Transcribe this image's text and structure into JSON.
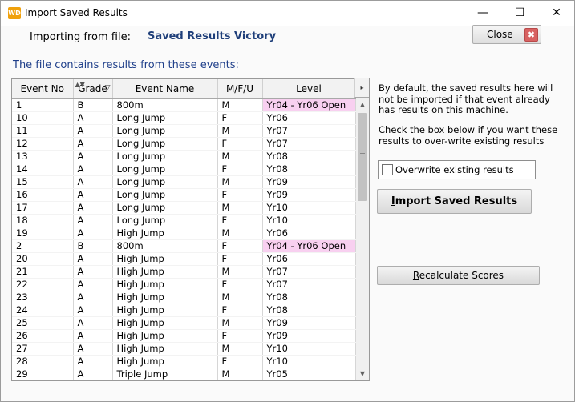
{
  "window": {
    "title": "Import Saved Results",
    "icon_name": "app-logo-icon",
    "app_icon_text": "WD",
    "min_glyph": "—",
    "max_glyph": "☐",
    "close_glyph": "✕"
  },
  "header": {
    "import_label": "Importing from file:",
    "file_name": "Saved Results Victory",
    "close_button": "Close",
    "close_icon_glyph": "✖"
  },
  "events_heading": "The file contains results from these events:",
  "grid": {
    "columns": [
      "Event No",
      "Grade",
      "Event Name",
      "M/F/U",
      "Level"
    ],
    "sort_glyph": "▲▼",
    "filter_glyph": "▽",
    "col_scroll_glyph": "▸",
    "scroll_up_glyph": "▲",
    "scroll_down_glyph": "▼",
    "rows": [
      {
        "event_no": "1",
        "grade": "B",
        "event_name": "800m",
        "mfu": "M",
        "level": "Yr04 - Yr06 Open",
        "highlight": true
      },
      {
        "event_no": "10",
        "grade": "A",
        "event_name": "Long Jump",
        "mfu": "F",
        "level": "Yr06"
      },
      {
        "event_no": "11",
        "grade": "A",
        "event_name": "Long Jump",
        "mfu": "M",
        "level": "Yr07"
      },
      {
        "event_no": "12",
        "grade": "A",
        "event_name": "Long Jump",
        "mfu": "F",
        "level": "Yr07"
      },
      {
        "event_no": "13",
        "grade": "A",
        "event_name": "Long Jump",
        "mfu": "M",
        "level": "Yr08"
      },
      {
        "event_no": "14",
        "grade": "A",
        "event_name": "Long Jump",
        "mfu": "F",
        "level": "Yr08"
      },
      {
        "event_no": "15",
        "grade": "A",
        "event_name": "Long Jump",
        "mfu": "M",
        "level": "Yr09"
      },
      {
        "event_no": "16",
        "grade": "A",
        "event_name": "Long Jump",
        "mfu": "F",
        "level": "Yr09"
      },
      {
        "event_no": "17",
        "grade": "A",
        "event_name": "Long Jump",
        "mfu": "M",
        "level": "Yr10"
      },
      {
        "event_no": "18",
        "grade": "A",
        "event_name": "Long Jump",
        "mfu": "F",
        "level": "Yr10"
      },
      {
        "event_no": "19",
        "grade": "A",
        "event_name": "High Jump",
        "mfu": "M",
        "level": "Yr06"
      },
      {
        "event_no": "2",
        "grade": "B",
        "event_name": "800m",
        "mfu": "F",
        "level": "Yr04 - Yr06 Open",
        "highlight": true
      },
      {
        "event_no": "20",
        "grade": "A",
        "event_name": "High Jump",
        "mfu": "F",
        "level": "Yr06"
      },
      {
        "event_no": "21",
        "grade": "A",
        "event_name": "High Jump",
        "mfu": "M",
        "level": "Yr07"
      },
      {
        "event_no": "22",
        "grade": "A",
        "event_name": "High Jump",
        "mfu": "F",
        "level": "Yr07"
      },
      {
        "event_no": "23",
        "grade": "A",
        "event_name": "High Jump",
        "mfu": "M",
        "level": "Yr08"
      },
      {
        "event_no": "24",
        "grade": "A",
        "event_name": "High Jump",
        "mfu": "F",
        "level": "Yr08"
      },
      {
        "event_no": "25",
        "grade": "A",
        "event_name": "High Jump",
        "mfu": "M",
        "level": "Yr09"
      },
      {
        "event_no": "26",
        "grade": "A",
        "event_name": "High Jump",
        "mfu": "F",
        "level": "Yr09"
      },
      {
        "event_no": "27",
        "grade": "A",
        "event_name": "High Jump",
        "mfu": "M",
        "level": "Yr10"
      },
      {
        "event_no": "28",
        "grade": "A",
        "event_name": "High Jump",
        "mfu": "F",
        "level": "Yr10"
      },
      {
        "event_no": "29",
        "grade": "A",
        "event_name": "Triple Jump",
        "mfu": "M",
        "level": "Yr05"
      }
    ]
  },
  "info": {
    "default_note": "By default, the saved results here will not be imported if that event already has results on this machine.",
    "check_note": "Check the box below if you want these results to over-write existing results"
  },
  "overwrite": {
    "label": "Overwrite existing results",
    "checked": false
  },
  "buttons": {
    "import": "Import Saved Results",
    "recalculate": "Recalculate Scores"
  },
  "colors": {
    "heading_blue": "#1f3f8a",
    "file_name_blue": "#1f3f7a",
    "highlight_pink": "#f8d0f0",
    "app_icon_orange": "#f0a10c"
  }
}
